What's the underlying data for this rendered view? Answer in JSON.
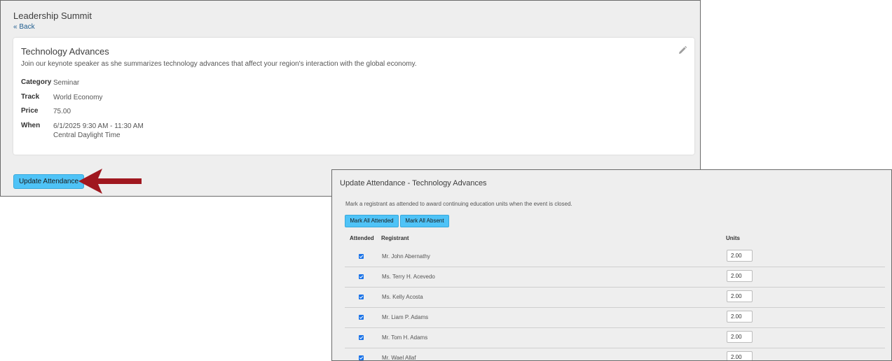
{
  "page": {
    "title": "Leadership Summit",
    "back_label": "« Back"
  },
  "session": {
    "title": "Technology Advances",
    "description": "Join our keynote speaker as she summarizes technology advances that affect your region's interaction with the global economy.",
    "details": [
      {
        "label": "Category",
        "value": "Seminar"
      },
      {
        "label": "Track",
        "value": "World Economy"
      },
      {
        "label": "Price",
        "value": "75.00"
      },
      {
        "label": "When",
        "value": "6/1/2025 9:30 AM - 11:30 AM",
        "value2": "Central Daylight Time"
      }
    ],
    "edit_icon": "pencil-icon"
  },
  "update_button_label": "Update Attendance",
  "annotation": {
    "arrow_color": "#a0171f"
  },
  "modal": {
    "title": "Update Attendance - Technology Advances",
    "description": "Mark a registrant as attended to award continuing education units when the event is closed.",
    "mark_all_attended_label": "Mark All Attended",
    "mark_all_absent_label": "Mark All Absent",
    "columns": {
      "attended": "Attended",
      "registrant": "Registrant",
      "units": "Units"
    },
    "rows": [
      {
        "attended": true,
        "name": "Mr. John Abernathy",
        "units": "2.00"
      },
      {
        "attended": true,
        "name": "Ms. Terry H. Acevedo",
        "units": "2.00"
      },
      {
        "attended": true,
        "name": "Ms. Kelly Acosta",
        "units": "2.00"
      },
      {
        "attended": true,
        "name": "Mr. Liam P. Adams",
        "units": "2.00"
      },
      {
        "attended": true,
        "name": "Mr. Tom H. Adams",
        "units": "2.00"
      },
      {
        "attended": true,
        "name": "Mr. Wael Allaf",
        "units": "2.00"
      }
    ]
  },
  "colors": {
    "accent_button": "#4fc3f7",
    "checkbox": "#1a73e8",
    "link": "#1f5d8f"
  }
}
